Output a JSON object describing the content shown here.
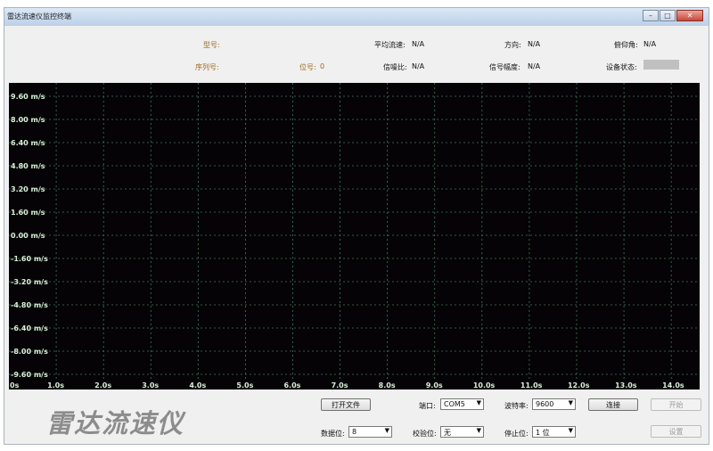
{
  "window": {
    "title": "雷达流速仪监控终端"
  },
  "info": {
    "model_label": "型号:",
    "serial_label": "序列号:",
    "position_label": "位号:",
    "position_value": "0",
    "avg_speed_label": "平均流速:",
    "avg_speed_value": "N/A",
    "snr_label": "信噪比:",
    "snr_value": "N/A",
    "direction_label": "方向:",
    "direction_value": "N/A",
    "amplitude_label": "信号幅度:",
    "amplitude_value": "N/A",
    "pitch_label": "俯仰角:",
    "pitch_value": "N/A",
    "status_label": "设备状态:"
  },
  "chart_data": {
    "type": "line",
    "title": "",
    "xlabel": "",
    "ylabel": "",
    "y_ticks": [
      "9.60 m/s",
      "8.00 m/s",
      "6.40 m/s",
      "4.80 m/s",
      "3.20 m/s",
      "1.60 m/s",
      "0.00 m/s",
      "-1.60 m/s",
      "-3.20 m/s",
      "-4.80 m/s",
      "-6.40 m/s",
      "-8.00 m/s",
      "-9.60 m/s"
    ],
    "x_ticks": [
      "0s",
      "1.0s",
      "2.0s",
      "3.0s",
      "4.0s",
      "5.0s",
      "6.0s",
      "7.0s",
      "8.0s",
      "9.0s",
      "10.0s",
      "11.0s",
      "12.0s",
      "13.0s",
      "14.0s"
    ],
    "xlim": [
      0,
      14.6
    ],
    "ylim": [
      -9.6,
      9.6
    ],
    "grid": true,
    "series": [],
    "colors": {
      "background": "#050305",
      "grid": "#3f7a5a",
      "labels": "#d8f0d8"
    }
  },
  "brand": {
    "text": "雷达流速仪"
  },
  "controls": {
    "open_file": "打开文件",
    "connect": "连接",
    "start": "开始",
    "settings": "设置",
    "port_label": "端口:",
    "port_value": "COM5",
    "baud_label": "波特率:",
    "baud_value": "9600",
    "databits_label": "数据位:",
    "databits_value": "8",
    "parity_label": "校验位:",
    "parity_value": "无",
    "stopbits_label": "停止位:",
    "stopbits_value": "1 位"
  }
}
